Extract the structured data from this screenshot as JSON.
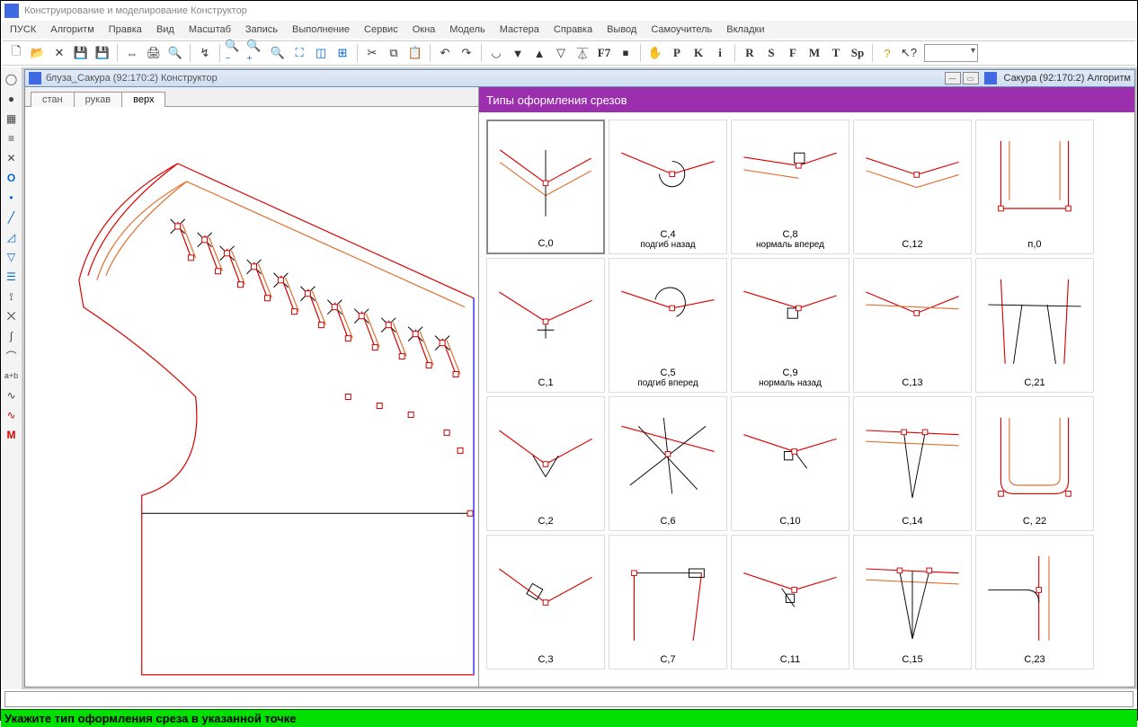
{
  "title": "Конструирование и моделирование  Конструктор",
  "menu": [
    "ПУСК",
    "Алгоритм",
    "Правка",
    "Вид",
    "Масштаб",
    "Запись",
    "Выполнение",
    "Сервис",
    "Окна",
    "Модель",
    "Мастера",
    "Справка",
    "Вывод",
    "Самоучитель",
    "Вкладки"
  ],
  "toolbar_letters": [
    "F7",
    "P",
    "K",
    "i",
    "R",
    "S",
    "F",
    "M",
    "T",
    "Sp"
  ],
  "doc_title": "блуза_Сакура (92:170:2) Конструктор",
  "right_doc_title": "Сакура (92:170:2) Алгоритм",
  "tabs": {
    "items": [
      "стан",
      "рукав",
      "верх"
    ],
    "active_index": 2
  },
  "panel_header": "Типы оформления срезов",
  "cells_main": [
    {
      "label": "С,0",
      "sub": ""
    },
    {
      "label": "С,4",
      "sub": "подгиб назад"
    },
    {
      "label": "С,8",
      "sub": "нормаль вперед"
    },
    {
      "label": "С,12",
      "sub": ""
    },
    {
      "label": "п,0",
      "sub": ""
    },
    {
      "label": "С,1",
      "sub": ""
    },
    {
      "label": "С,5",
      "sub": "подгиб вперед"
    },
    {
      "label": "С,9",
      "sub": "нормаль назад"
    },
    {
      "label": "С,13",
      "sub": ""
    },
    {
      "label": "С,21",
      "sub": ""
    },
    {
      "label": "С,2",
      "sub": ""
    },
    {
      "label": "С,6",
      "sub": ""
    },
    {
      "label": "С,10",
      "sub": ""
    },
    {
      "label": "С,14",
      "sub": ""
    },
    {
      "label": "С, 22",
      "sub": ""
    },
    {
      "label": "С,3",
      "sub": ""
    },
    {
      "label": "С,7",
      "sub": ""
    },
    {
      "label": "С,11",
      "sub": ""
    },
    {
      "label": "С,15",
      "sub": ""
    },
    {
      "label": "С,23",
      "sub": ""
    }
  ],
  "status": "Укажите тип оформления среза в указанной точке"
}
